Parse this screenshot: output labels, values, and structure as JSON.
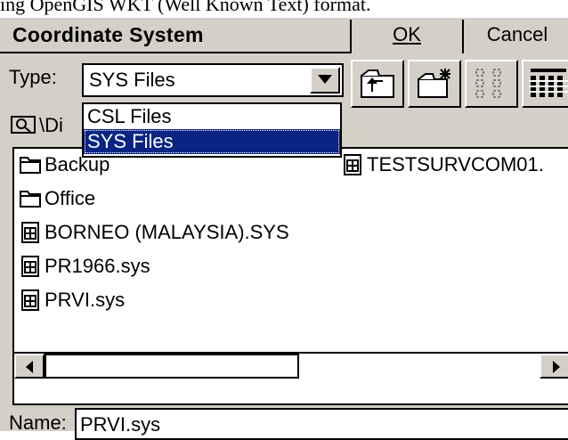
{
  "caption": "ing OpenGIS WKT (Well Known Text) format.",
  "dialog": {
    "title": "Coordinate System",
    "ok_label": "OK",
    "cancel_label": "Cancel"
  },
  "type": {
    "label": "Type:",
    "value": "SYS Files",
    "options": [
      "CSL Files",
      "SYS Files"
    ],
    "selected_index": 1
  },
  "path": "\\Di",
  "files": [
    {
      "name": "Backup",
      "kind": "folder"
    },
    {
      "name": "Office",
      "kind": "folder"
    },
    {
      "name": "BORNEO (MALAYSIA).SYS",
      "kind": "file"
    },
    {
      "name": "PR1966.sys",
      "kind": "file"
    },
    {
      "name": "PRVI.sys",
      "kind": "file"
    },
    {
      "name": "TESTSURVCOM01.",
      "kind": "file"
    }
  ],
  "name": {
    "label": "Name:",
    "value": "PRVI.sys"
  },
  "icons": {
    "toolbar": [
      "folder-up-icon",
      "new-folder-icon",
      "list-view-icon",
      "details-view-icon"
    ],
    "path": "drive-icon",
    "scroll": [
      "scroll-left-icon",
      "scroll-right-icon"
    ]
  },
  "colors": {
    "dialog_bg": "#d4d0c8",
    "selection": "#0a2484"
  }
}
